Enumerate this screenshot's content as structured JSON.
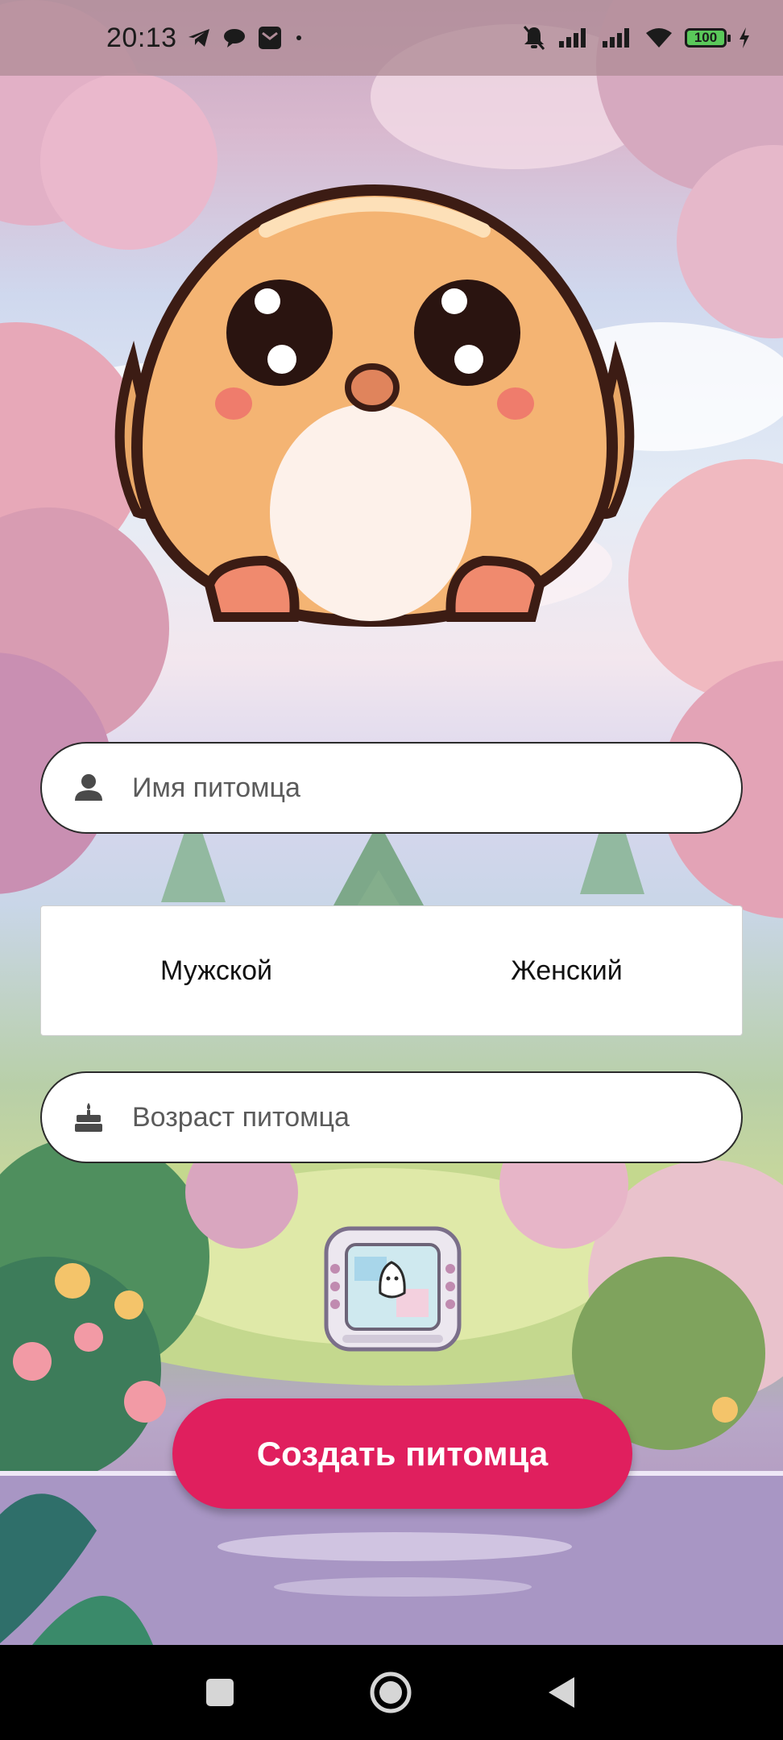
{
  "status_bar": {
    "time": "20:13",
    "battery_level": "100",
    "left_icons": [
      "telegram-icon",
      "chat-bubble-icon",
      "mail-app-icon",
      "dot-icon"
    ],
    "right_icons": [
      "bell-muted-icon",
      "signal-icon",
      "signal-icon",
      "wifi-icon",
      "battery-icon",
      "charging-icon"
    ]
  },
  "form": {
    "name": {
      "placeholder": "Имя питомца",
      "icon": "person-icon"
    },
    "gender": {
      "options": [
        "Мужской",
        "Женский"
      ]
    },
    "age": {
      "placeholder": "Возраст питомца",
      "icon": "cake-icon"
    }
  },
  "actions": {
    "create_label": "Создать питомца"
  },
  "colors": {
    "accent": "#e01f5e",
    "status_bar": "#af8c96",
    "input_background": "#ffffff",
    "input_border": "#2b2b2b"
  },
  "nav_bar": {
    "buttons": [
      "recents-square-icon",
      "home-circle-icon",
      "back-triangle-icon"
    ]
  }
}
